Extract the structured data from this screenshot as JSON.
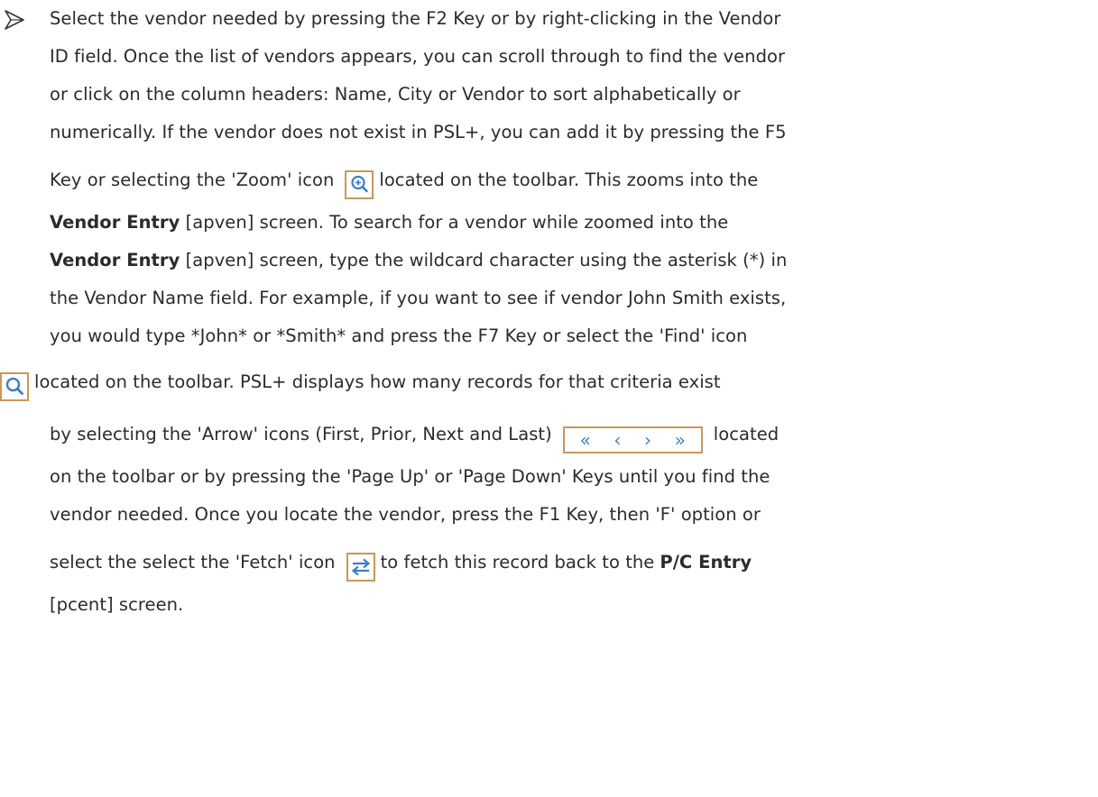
{
  "content": {
    "l1": "Select the vendor needed by pressing the F2 Key or by right-clicking in the Vendor",
    "l2": "ID field. Once the list of vendors appears, you can scroll through to find the vendor",
    "l3": "or click on the column headers: Name, City or Vendor to sort alphabetically or",
    "l4": "numerically.  If the vendor does not exist in PSL+, you can add it by pressing the F5",
    "l5a": "Key or selecting the 'Zoom' icon",
    "l5b": "located on the toolbar.  This zooms into the",
    "l6a": "Vendor Entry",
    "l6b": " [apven] screen.  To search for a vendor while zoomed into the",
    "l7a": "Vendor Entry",
    "l7b": " [apven] screen, type the wildcard character using the asterisk (*) in",
    "l8": "the Vendor Name field.  For example, if you want to see if vendor John Smith exists,",
    "l9": "you would type *John* or *Smith* and press the F7 Key or select the 'Find' icon",
    "l10": "located on the toolbar.  PSL+ displays how many records for that criteria exist",
    "l11a": "by selecting the 'Arrow' icons (First, Prior, Next and Last)",
    "l11b": "located",
    "l12": "on the toolbar or by pressing the 'Page Up' or 'Page Down' Keys until you find the",
    "l13": "vendor needed. Once you locate the vendor, press the F1 Key, then 'F' option or",
    "l14a": "select the select the 'Fetch' icon",
    "l14b": "to fetch this record back to the",
    "l14c": "P/C Entry",
    "l15": "[pcent] screen."
  },
  "icons": {
    "zoom": "zoom-in-icon",
    "find": "search-icon",
    "nav": [
      "first-icon",
      "prior-icon",
      "next-icon",
      "last-icon"
    ],
    "fetch": "fetch-icon"
  },
  "colors": {
    "icon_border": "#c8985a",
    "icon_blue": "#3d7fc4",
    "text": "#2b2b2b"
  }
}
